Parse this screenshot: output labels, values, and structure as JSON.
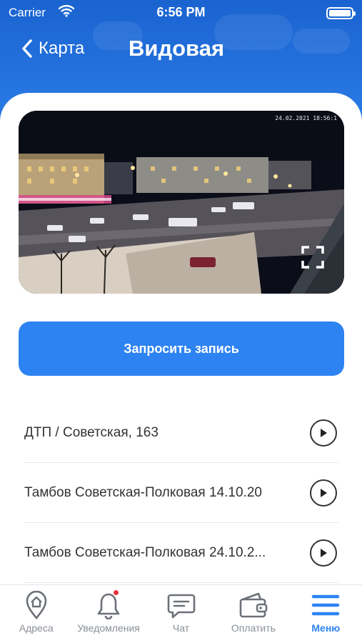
{
  "status_bar": {
    "carrier": "Carrier",
    "time": "6:56 PM"
  },
  "nav": {
    "back_label": "Карта",
    "title": "Видовая"
  },
  "camera": {
    "timestamp": "24.02.2021 18:56:1"
  },
  "request_button": {
    "label": "Запросить запись"
  },
  "records": [
    {
      "label": "ДТП / Советская, 163"
    },
    {
      "label": "Тамбов Советская-Полковая 14.10.20"
    },
    {
      "label": "Тамбов Советская-Полковая 24.10.2..."
    }
  ],
  "tabbar": {
    "items": [
      {
        "label": "Адреса",
        "icon": "map-pin-home-icon",
        "active": false
      },
      {
        "label": "Уведомления",
        "icon": "bell-icon",
        "active": false,
        "badge": true
      },
      {
        "label": "Чат",
        "icon": "chat-icon",
        "active": false
      },
      {
        "label": "Оплатить",
        "icon": "wallet-icon",
        "active": false
      },
      {
        "label": "Меню",
        "icon": "menu-icon",
        "active": true
      }
    ]
  },
  "colors": {
    "accent": "#2d83f2",
    "header": "#1a63d0",
    "badge": "#e7343b"
  }
}
